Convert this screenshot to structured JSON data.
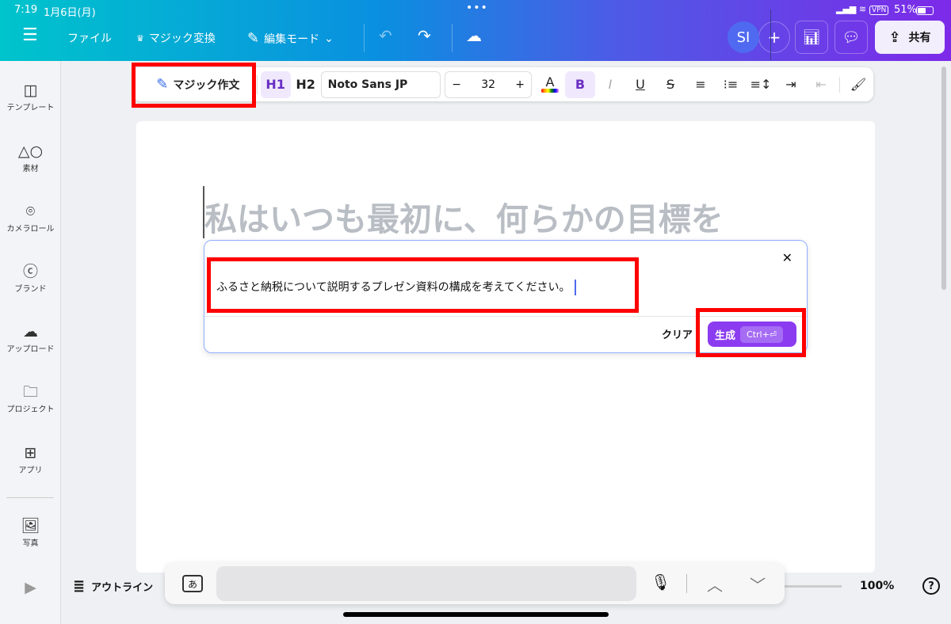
{
  "status": {
    "time": "7:19",
    "date": "1月6日(月)",
    "vpn": "VPN",
    "battery": "51%"
  },
  "header": {
    "menu_icon": "hamburger-icon",
    "file": "ファイル",
    "magic_switch": "マジック変換",
    "edit_mode": "編集モード",
    "avatar": "SI",
    "share": "共有"
  },
  "toolbar": {
    "magic_write": "マジック作文",
    "h1": "H1",
    "h2": "H2",
    "font": "Noto Sans JP",
    "minus": "−",
    "size": "32",
    "plus": "+",
    "color_a": "A",
    "bold": "B",
    "italic": "I",
    "underline": "U",
    "strike": "S"
  },
  "sidebar": {
    "items": [
      {
        "label": "テンプレート",
        "icon": "template-icon"
      },
      {
        "label": "素材",
        "icon": "elements-icon"
      },
      {
        "label": "カメラロール",
        "icon": "camera-icon"
      },
      {
        "label": "ブランド",
        "icon": "brand-icon"
      },
      {
        "label": "アップロード",
        "icon": "upload-icon"
      },
      {
        "label": "プロジェクト",
        "icon": "folder-icon"
      },
      {
        "label": "アプリ",
        "icon": "apps-icon"
      },
      {
        "label": "写真",
        "icon": "photo-icon"
      }
    ]
  },
  "canvas": {
    "heading": "私はいつも最初に、何らかの目標を"
  },
  "dialog": {
    "prompt": "ふるさと納税について説明するプレゼン資料の構成を考えてください。",
    "clear": "クリア",
    "generate": "生成",
    "shortcut": "Ctrl+⏎"
  },
  "bottom": {
    "outline": "アウトライン",
    "zoom": "100%",
    "help": "?",
    "kana": "あ"
  }
}
